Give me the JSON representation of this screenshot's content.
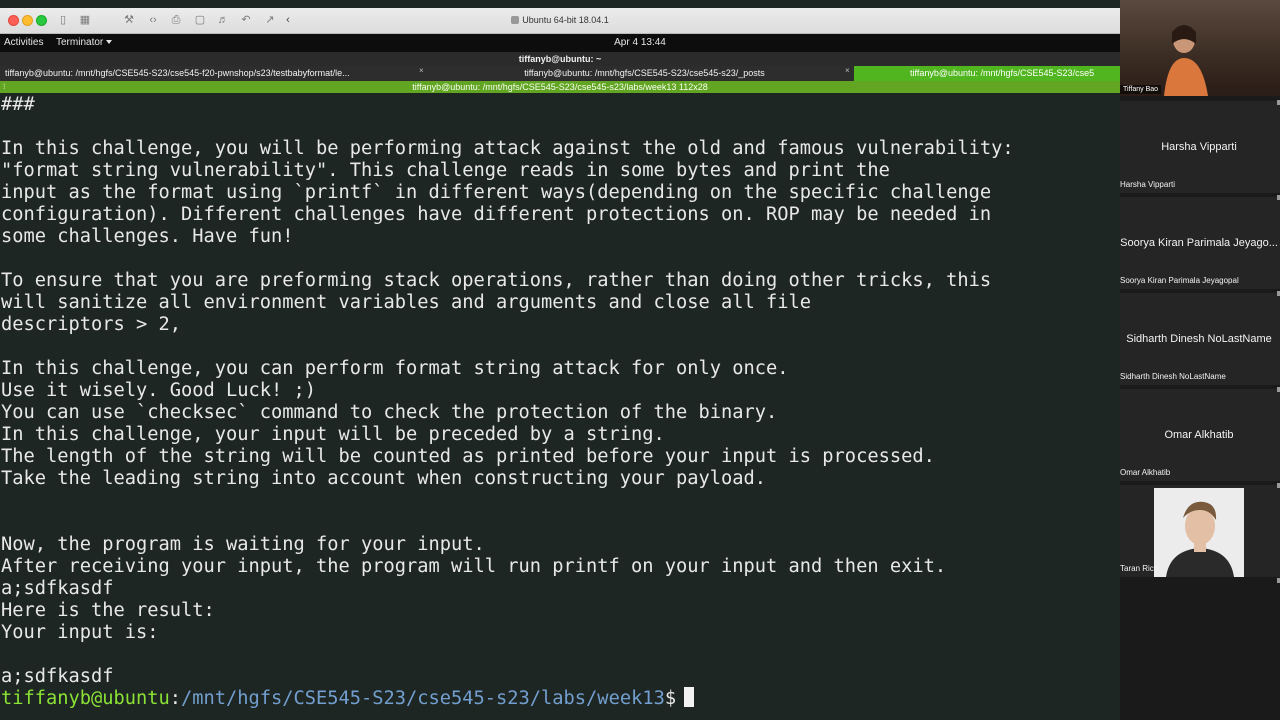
{
  "vm_window": {
    "title": "Ubuntu 64-bit 18.04.1"
  },
  "gnome_bar": {
    "activities": "Activities",
    "app_menu": "Terminator",
    "clock": "Apr 4  13:44"
  },
  "terminal_window": {
    "title": "tiffanyb@ubuntu: ~",
    "tabs": [
      {
        "label": "tiffanyb@ubuntu: /mnt/hgfs/CSE545-S23/cse545-f20-pwnshop/s23/testbabyformat/le...",
        "active": false
      },
      {
        "label": "tiffanyb@ubuntu: /mnt/hgfs/CSE545-S23/cse545-s23/_posts",
        "active": false
      },
      {
        "label": "tiffanyb@ubuntu: /mnt/hgfs/CSE545-S23/cse5",
        "active": true
      }
    ],
    "pane_title": "tiffanyb@ubuntu: /mnt/hgfs/CSE545-S23/cse545-s23/labs/week13 112x28",
    "colors": {
      "active_tab": "#51b51f",
      "pane_title": "#62a523",
      "background": "#1e2624"
    }
  },
  "terminal": {
    "lines": [
      "###",
      "",
      "In this challenge, you will be performing attack against the old and famous vulnerability:",
      "\"format string vulnerability\". This challenge reads in some bytes and print the",
      "input as the format using `printf` in different ways(depending on the specific challenge",
      "configuration). Different challenges have different protections on. ROP may be needed in",
      "some challenges. Have fun!",
      "",
      "To ensure that you are preforming stack operations, rather than doing other tricks, this",
      "will sanitize all environment variables and arguments and close all file",
      "descriptors > 2,",
      "",
      "In this challenge, you can perform format string attack for only once.",
      "Use it wisely. Good Luck! ;)",
      "You can use `checksec` command to check the protection of the binary.",
      "In this challenge, your input will be preceded by a string.",
      "The length of the string will be counted as printed before your input is processed.",
      "Take the leading string into account when constructing your payload.",
      "",
      "",
      "Now, the program is waiting for your input.",
      "After receiving your input, the program will run printf on your input and then exit.",
      "a;sdfkasdf",
      "Here is the result:",
      "Your input is:",
      "",
      "a;sdfkasdf"
    ],
    "prompt": {
      "user_host": "tiffanyb@ubuntu",
      "colon": ":",
      "path": "/mnt/hgfs/CSE545-S23/cse545-s23/labs/week13",
      "symbol": "$"
    }
  },
  "zoom": {
    "participants": [
      {
        "name": "Tiffany Bao",
        "has_video": true
      },
      {
        "name": "Harsha Vipparti",
        "display": "Harsha Vipparti",
        "has_video": false
      },
      {
        "name": "Soorya Kiran Parimala Jeyagopal",
        "display": "Soorya Kiran Parimala Jeyago...",
        "has_video": false
      },
      {
        "name": "Sidharth Dinesh NoLastName",
        "display": "Sidharth Dinesh NoLastName",
        "has_video": false
      },
      {
        "name": "Omar Alkhatib",
        "display": "Omar Alkhatib",
        "has_video": false
      },
      {
        "name": "Taran Rich",
        "has_video": true
      }
    ]
  }
}
